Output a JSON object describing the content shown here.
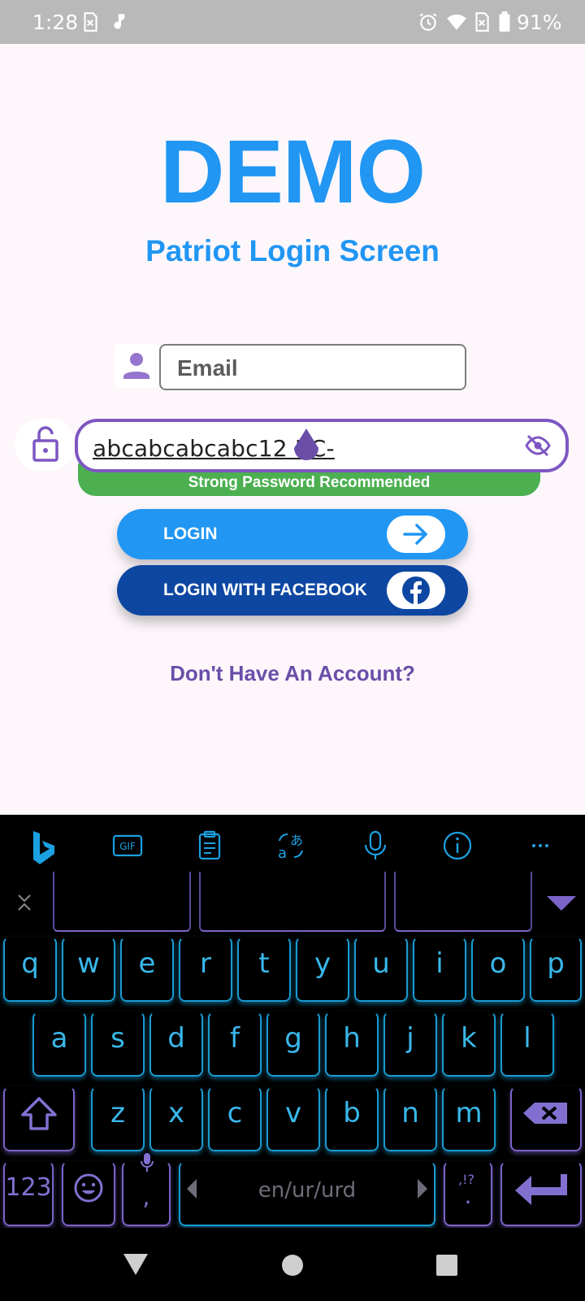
{
  "status_bar": {
    "time": "1:28",
    "battery": "91%"
  },
  "app": {
    "title": "DEMO",
    "subtitle": "Patriot Login Screen",
    "email_placeholder": "Email",
    "password_value": "abcabcabcabc12 BC-",
    "password_strength": "Strong Password Recommended",
    "login_label": "LOGIN",
    "facebook_label": "LOGIN WITH FACEBOOK",
    "signup_link": "Don't Have An Account?"
  },
  "keyboard": {
    "row1": [
      "q",
      "w",
      "e",
      "r",
      "t",
      "y",
      "u",
      "i",
      "o",
      "p"
    ],
    "row2": [
      "a",
      "s",
      "d",
      "f",
      "g",
      "h",
      "j",
      "k",
      "l"
    ],
    "row3": [
      "z",
      "x",
      "c",
      "v",
      "b",
      "n",
      "m"
    ],
    "numbers_label": "123",
    "comma_label": ",",
    "period_label": ".",
    "punct_hint": ",!?",
    "space_label": "en/ur/urd"
  },
  "colors": {
    "accent_blue": "#2196f3",
    "facebook_blue": "#0d47a1",
    "focus_purple": "#7e57c2",
    "strength_green": "#4caf50"
  }
}
